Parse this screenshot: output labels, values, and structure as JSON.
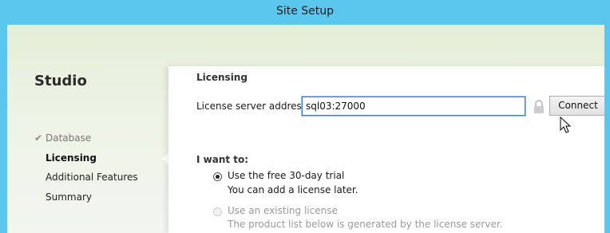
{
  "window": {
    "title": "Site Setup"
  },
  "sidebar": {
    "title": "Studio",
    "items": [
      {
        "label": "Database",
        "state": "completed"
      },
      {
        "label": "Licensing",
        "state": "current"
      },
      {
        "label": "Additional Features",
        "state": "pending"
      },
      {
        "label": "Summary",
        "state": "pending"
      }
    ]
  },
  "main": {
    "section_title": "Licensing",
    "license_server": {
      "label": "License server address:",
      "value": "sql03:27000"
    },
    "connect_label": "Connect",
    "choice_heading": "I want to:",
    "options": [
      {
        "label": "Use the free 30-day trial",
        "description": "You can add a license later.",
        "selected": true,
        "enabled": true
      },
      {
        "label": "Use an existing license",
        "description": "The product list below is generated by the license server.",
        "selected": false,
        "enabled": false
      }
    ]
  },
  "colors": {
    "titlebar": "#5bc7ee",
    "input_focus": "#3c78d8"
  }
}
